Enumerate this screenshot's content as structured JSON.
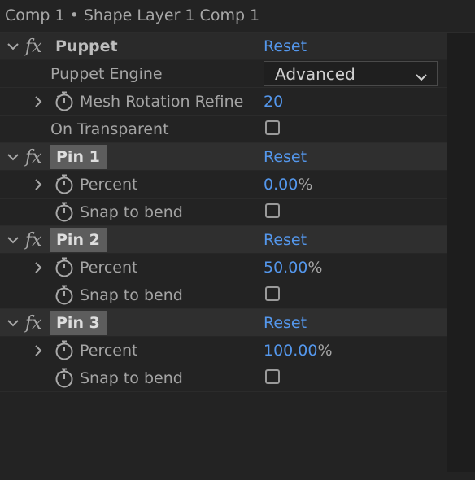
{
  "window": {
    "title": "Comp 1 • Shape Layer 1 Comp 1"
  },
  "effects": {
    "puppet": {
      "name": "Puppet",
      "reset": "Reset",
      "engine_label": "Puppet Engine",
      "engine_value": "Advanced",
      "mesh_label": "Mesh Rotation Refine",
      "mesh_value": "20",
      "transparent_label": "On Transparent"
    },
    "pins": [
      {
        "name": "Pin 1",
        "reset": "Reset",
        "percent_label": "Percent",
        "percent_value": "0.00",
        "percent_unit": "%",
        "snap_label": "Snap to bend"
      },
      {
        "name": "Pin 2",
        "reset": "Reset",
        "percent_label": "Percent",
        "percent_value": "50.00",
        "percent_unit": "%",
        "snap_label": "Snap to bend"
      },
      {
        "name": "Pin 3",
        "reset": "Reset",
        "percent_label": "Percent",
        "percent_value": "100.00",
        "percent_unit": "%",
        "snap_label": "Snap to bend"
      }
    ]
  },
  "icons": {
    "fx": "fx",
    "stopwatch": "stopwatch-icon",
    "expand": "chevron-right-icon",
    "collapse": "chevron-down-icon"
  },
  "colors": {
    "accent": "#5497ec",
    "background": "#232323",
    "effect_header": "#2f2f2f"
  }
}
